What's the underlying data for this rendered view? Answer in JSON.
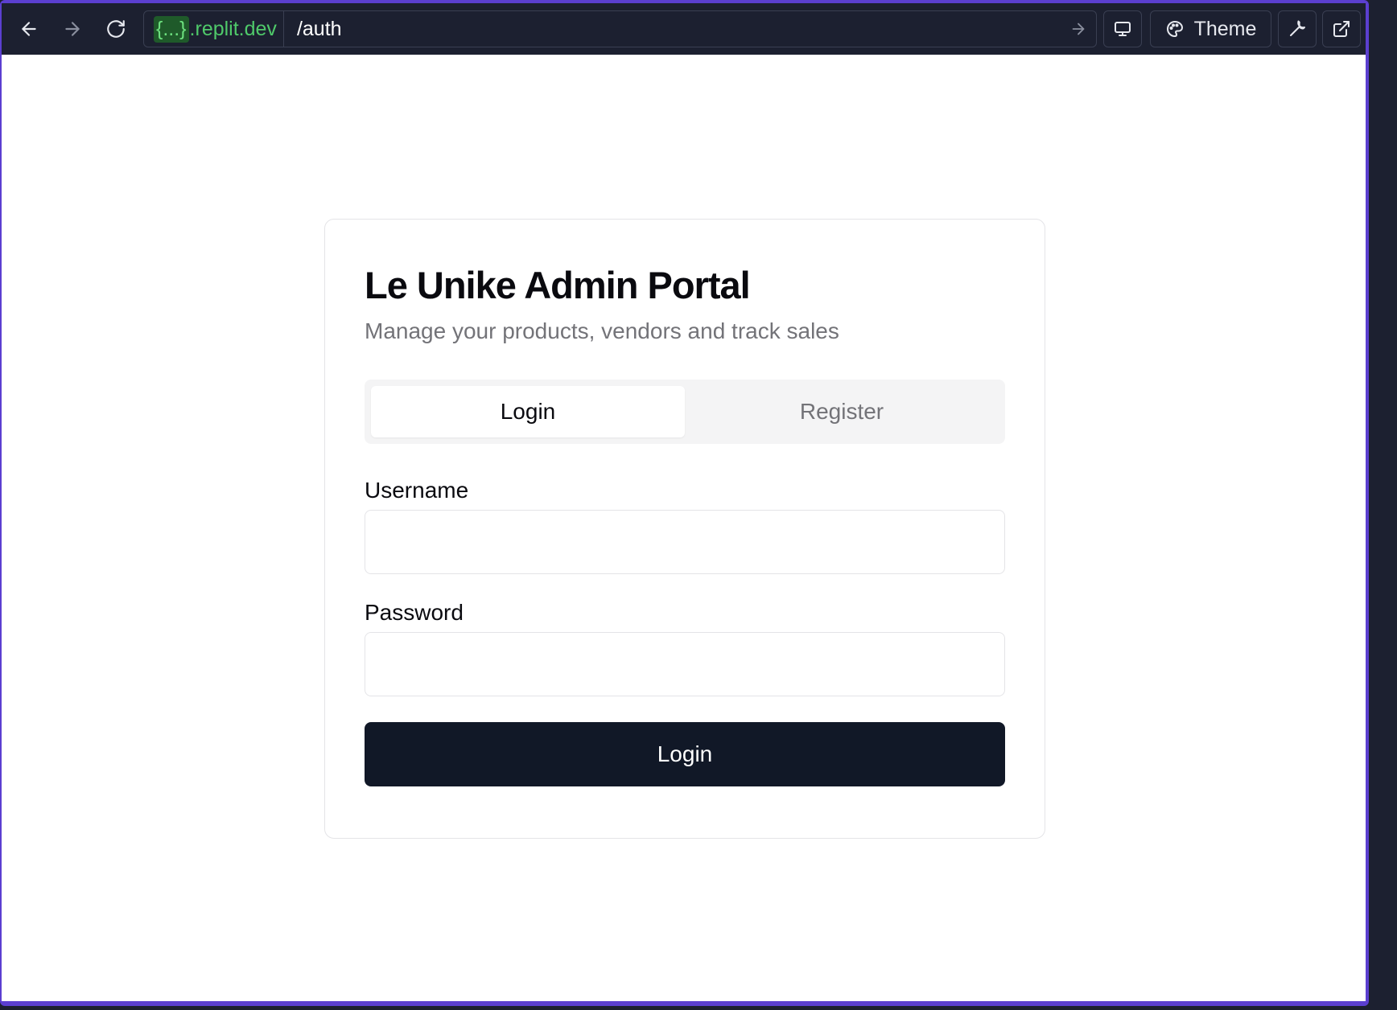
{
  "browser": {
    "url_domain_braces": "{...}",
    "url_domain_suffix": ".replit.dev",
    "url_path": "/auth",
    "theme_label": "Theme",
    "icons": {
      "back": "arrow-left-icon",
      "forward": "arrow-right-icon",
      "reload": "refresh-icon",
      "go": "arrow-right-icon",
      "devices": "monitor-icon",
      "theme": "palette-icon",
      "tools": "wrench-icon",
      "external": "external-link-icon"
    }
  },
  "auth": {
    "title": "Le Unike Admin Portal",
    "subtitle": "Manage your products, vendors and track sales",
    "tabs": [
      {
        "label": "Login",
        "active": true
      },
      {
        "label": "Register",
        "active": false
      }
    ],
    "username_label": "Username",
    "username_value": "",
    "password_label": "Password",
    "password_value": "",
    "submit_label": "Login"
  },
  "colors": {
    "frame_accent": "#5b3fd0",
    "toolbar_bg": "#1c2030",
    "url_green": "#4fc96a",
    "primary_button": "#111827"
  }
}
